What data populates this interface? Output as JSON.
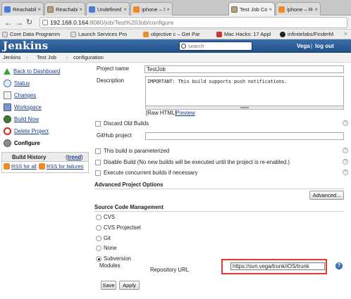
{
  "browser": {
    "tabs": [
      {
        "title": "Reachability",
        "icon": "google-icon"
      },
      {
        "title": "Reachability",
        "icon": "jenkins-icon"
      },
      {
        "title": "Undefined s",
        "icon": "google-icon"
      },
      {
        "title": "iphone – SC",
        "icon": "stackoverflow-icon"
      },
      {
        "title": "Test Job Co",
        "icon": "jenkins-icon",
        "active": true
      },
      {
        "title": "iphone – Re",
        "icon": "stackoverflow-icon"
      }
    ],
    "url_host": "192.168.0.164",
    "url_path": ":8080/job/Test%20Job/configure",
    "bookmarks": [
      {
        "label": "Core Data Programm",
        "icon": "page-icon"
      },
      {
        "label": "Launch Services Pro",
        "icon": "page-icon"
      },
      {
        "label": "objective c – Get Par",
        "icon": "stackoverflow-icon"
      },
      {
        "label": "Mac Hacks: 17 Appl",
        "icon": "bookmark-icon"
      },
      {
        "label": "infinitelabs/FinderM",
        "icon": "github-icon"
      }
    ]
  },
  "jenkins": {
    "logo": "Jenkins",
    "search_placeholder": "search",
    "user": "Vega",
    "logout": "log out",
    "breadcrumbs": [
      "Jenkins",
      "Test Job",
      "configuration"
    ]
  },
  "sidebar": {
    "items": [
      {
        "label": "Back to Dashboard",
        "icon": "up-arrow-icon"
      },
      {
        "label": "Status",
        "icon": "search-icon"
      },
      {
        "label": "Changes",
        "icon": "notepad-icon"
      },
      {
        "label": "Workspace",
        "icon": "folder-icon"
      },
      {
        "label": "Build Now",
        "icon": "clock-icon"
      },
      {
        "label": "Delete Project",
        "icon": "no-entry-icon"
      },
      {
        "label": "Configure",
        "icon": "gear-icon",
        "current": true
      }
    ],
    "build_history": {
      "title": "Build History",
      "trend_open": "(",
      "trend_label": "trend",
      "trend_close": ")",
      "rss_all": "RSS for all",
      "rss_failures": "RSS for failures"
    }
  },
  "form": {
    "project_name_label": "Project name",
    "project_name_value": "TestJob",
    "description_label": "Description",
    "description_value": "IMPORTANT: This build supports push notifications.",
    "raw_html": "[Raw HTML]",
    "preview": "Preview",
    "discard_old_builds": "Discard Old Builds",
    "github_project_label": "GitHub project",
    "github_project_value": "",
    "parameterized": "This build is parameterized",
    "disable_build": "Disable Build (No new builds will be executed until the project is re-enabled.)",
    "concurrent": "Execute concurrent builds if necessary",
    "advanced_options_header": "Advanced Project Options",
    "advanced_button": "Advanced...",
    "scm_header": "Source Code Management",
    "scm_options": [
      "CVS",
      "CVS Projectset",
      "Git",
      "None",
      "Subversion"
    ],
    "scm_selected": "Subversion",
    "modules_label": "Modules",
    "repo_url_label": "Repository URL",
    "repo_url_value": "https://svn.vega/trunk/iOS/trunk",
    "save": "Save",
    "apply": "Apply"
  },
  "colors": {
    "jenkins_header": "#2e5f9a",
    "link": "#1a3d87",
    "highlight_box": "#e23b2e"
  }
}
